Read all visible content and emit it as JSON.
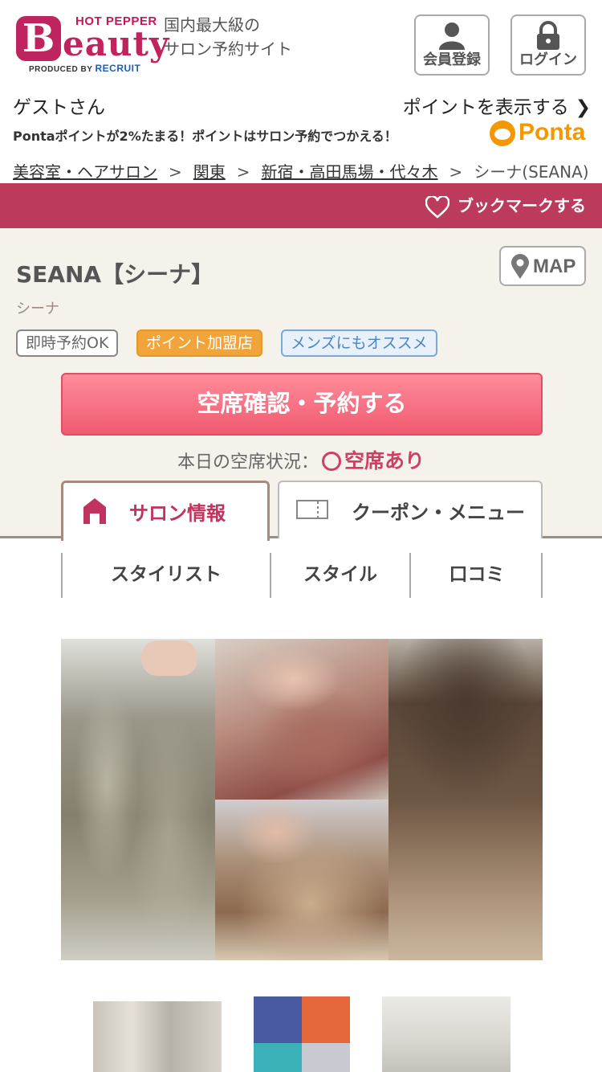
{
  "header": {
    "logo": {
      "brand_small": "HOT PEPPER",
      "brand_letter": "B",
      "brand_rest": "eauty",
      "produced_by": "PRODUCED BY",
      "company": "RECRUIT"
    },
    "tagline_line1": "国内最大級の",
    "tagline_line2": "サロン予約サイト",
    "register_label": "会員登録",
    "login_label": "ログイン"
  },
  "user": {
    "greeting": "ゲストさん",
    "points_link": "ポイントを表示する",
    "ponta_note": "Pontaポイントが2%たまる！ポイントはサロン予約でつかえる！",
    "ponta_logo_text": "Ponta"
  },
  "breadcrumb": {
    "items": [
      "美容室・ヘアサロン",
      "関東",
      "新宿・高田馬場・代々木"
    ],
    "current": "シーナ(SEANA)",
    "separator": ">"
  },
  "bookmark": {
    "label": "ブックマークする"
  },
  "salon": {
    "name": "SEANA【シーナ】",
    "kana": "シーナ",
    "map_label": "MAP",
    "tags": [
      "即時予約OK",
      "ポイント加盟店",
      "メンズにもオススメ"
    ],
    "reserve_label": "空席確認・予約する",
    "availability_label": "本日の空席状況：",
    "availability_value": "空席あり"
  },
  "tabs": [
    {
      "label": "サロン情報",
      "active": true
    },
    {
      "label": "クーポン・メニュー",
      "active": false
    }
  ],
  "subnav": [
    "スタイリスト",
    "スタイル",
    "口コミ"
  ],
  "colors": {
    "brand": "#c0245e",
    "bookmark_bar": "#bc3b5d",
    "panel_bg": "#f4f2ea",
    "reserve_button": "#f05a70",
    "point_tag": "#f0a43a",
    "mens_tag": "#4a86c6",
    "ponta": "#f39800"
  },
  "icons": {
    "register": "person-icon",
    "login": "lock-icon",
    "points": "chevron-right-icon",
    "bookmark": "heart-icon",
    "map": "map-pin-icon",
    "salon_info": "home-icon",
    "coupon": "ticket-icon",
    "availability": "circle-icon"
  }
}
